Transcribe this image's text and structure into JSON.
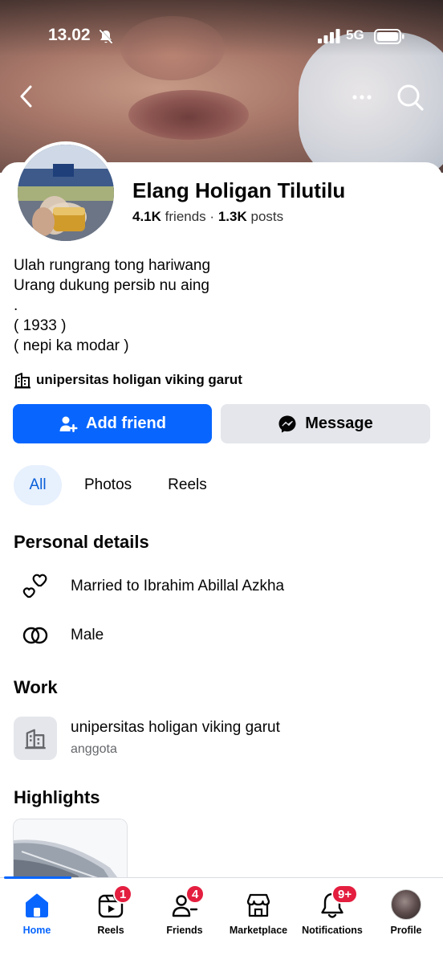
{
  "status_bar": {
    "time": "13.02",
    "network": "5G"
  },
  "profile": {
    "name": "Elang Holigan Tilutilu",
    "friends_count": "4.1K",
    "friends_label": "friends",
    "separator": "·",
    "posts_count": "1.3K",
    "posts_label": "posts",
    "bio": "Ulah rungrang tong hariwang\nUrang dukung persib nu aing\n.\n( 1933 )\n( nepi ka modar )",
    "workplace": "unipersitas holigan viking garut"
  },
  "actions": {
    "add_friend": "Add friend",
    "message": "Message"
  },
  "tabs": [
    {
      "label": "All"
    },
    {
      "label": "Photos"
    },
    {
      "label": "Reels"
    }
  ],
  "personal_details": {
    "title": "Personal details",
    "relationship": "Married to Ibrahim Abillal Azkha",
    "gender": "Male"
  },
  "work": {
    "title": "Work",
    "organization": "unipersitas holigan viking garut",
    "role": "anggota"
  },
  "highlights": {
    "title": "Highlights"
  },
  "bottom_nav": [
    {
      "label": "Home",
      "icon": "home-icon",
      "active": true
    },
    {
      "label": "Reels",
      "icon": "reels-icon",
      "badge": "1"
    },
    {
      "label": "Friends",
      "icon": "friends-icon",
      "badge": "4"
    },
    {
      "label": "Marketplace",
      "icon": "marketplace-icon"
    },
    {
      "label": "Notifications",
      "icon": "bell-icon",
      "badge": "9+"
    },
    {
      "label": "Profile",
      "icon": "profile-avatar"
    }
  ],
  "colors": {
    "accent": "#0866ff",
    "badge": "#e41e3f",
    "secondary_button": "#e4e6eb",
    "tab_active_bg": "#e7f0fd"
  }
}
